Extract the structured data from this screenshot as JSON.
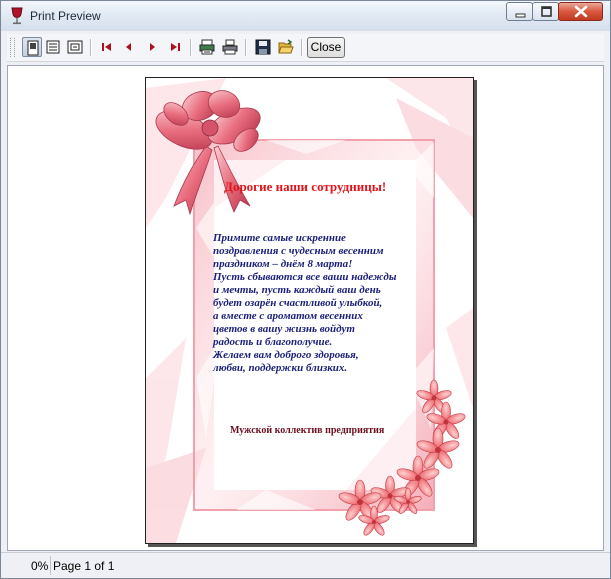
{
  "window": {
    "title": "Print Preview"
  },
  "toolbar": {
    "buttons": [
      {
        "name": "single-page-view",
        "icon": "single-page-icon"
      },
      {
        "name": "multi-page-view",
        "icon": "multi-page-icon"
      },
      {
        "name": "page-width-view",
        "icon": "page-width-icon"
      },
      {
        "name": "first-page",
        "icon": "first-page-icon"
      },
      {
        "name": "previous-page",
        "icon": "previous-page-icon"
      },
      {
        "name": "next-page",
        "icon": "next-page-icon"
      },
      {
        "name": "last-page",
        "icon": "last-page-icon"
      },
      {
        "name": "print-setup",
        "icon": "print-setup-icon"
      },
      {
        "name": "print",
        "icon": "printer-icon"
      },
      {
        "name": "save",
        "icon": "save-icon"
      },
      {
        "name": "open",
        "icon": "open-folder-icon"
      }
    ],
    "close_label": "Close"
  },
  "document": {
    "title": "Дорогие наши сотрудницы!",
    "body_lines": [
      "Примите самые искренние",
      "поздравления с чудесным весенним",
      "праздником – днём 8 марта!",
      "Пусть сбываются все ваши надежды",
      "и мечты, пусть каждый ваш день",
      "будет озарён счастливой улыбкой,",
      "а вместе с ароматом весенних",
      "цветов в вашу жизнь войдут",
      "радость и благополучие.",
      "Желаем вам доброго здоровья,",
      "любви, поддержки близких."
    ],
    "signature": "Мужской коллектив предприятия"
  },
  "status": {
    "zoom": "0%",
    "page": "Page 1 of 1"
  },
  "colors": {
    "title_red": "#e0141c",
    "body_blue": "#1c1f7a",
    "frame_pink": "#f2a0ac",
    "flower_pink": "#f07a7e"
  }
}
